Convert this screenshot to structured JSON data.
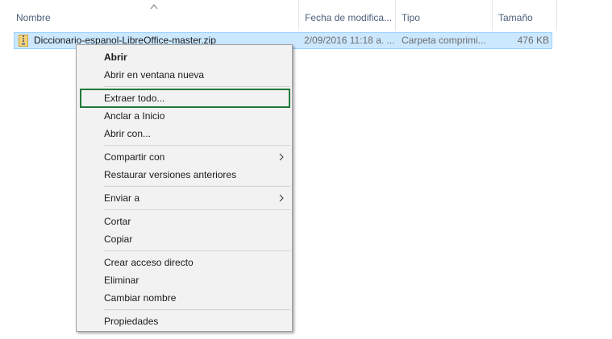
{
  "columns": {
    "name": "Nombre",
    "date": "Fecha de modifica...",
    "type": "Tipo",
    "size": "Tamaño"
  },
  "file": {
    "name": "Diccionario-espanol-LibreOffice-master.zip",
    "date": "2/09/2016 11:18 a. ...",
    "type": "Carpeta comprimi...",
    "size": "476 KB",
    "icon": "zip-folder-icon"
  },
  "context_menu": {
    "items": [
      {
        "label": "Abrir",
        "bold": true
      },
      {
        "label": "Abrir en ventana nueva"
      },
      {
        "label": "Extraer todo...",
        "highlighted": true
      },
      {
        "label": "Anclar a Inicio"
      },
      {
        "label": "Abrir con..."
      },
      {
        "label": "Compartir con",
        "submenu": true
      },
      {
        "label": "Restaurar versiones anteriores"
      },
      {
        "label": "Enviar a",
        "submenu": true
      },
      {
        "label": "Cortar"
      },
      {
        "label": "Copiar"
      },
      {
        "label": "Crear acceso directo"
      },
      {
        "label": "Eliminar"
      },
      {
        "label": "Cambiar nombre"
      },
      {
        "label": "Propiedades"
      }
    ]
  },
  "colors": {
    "selection": "#cce8ff",
    "highlight_border": "#1f7a3a",
    "header_text": "#4c607a"
  }
}
